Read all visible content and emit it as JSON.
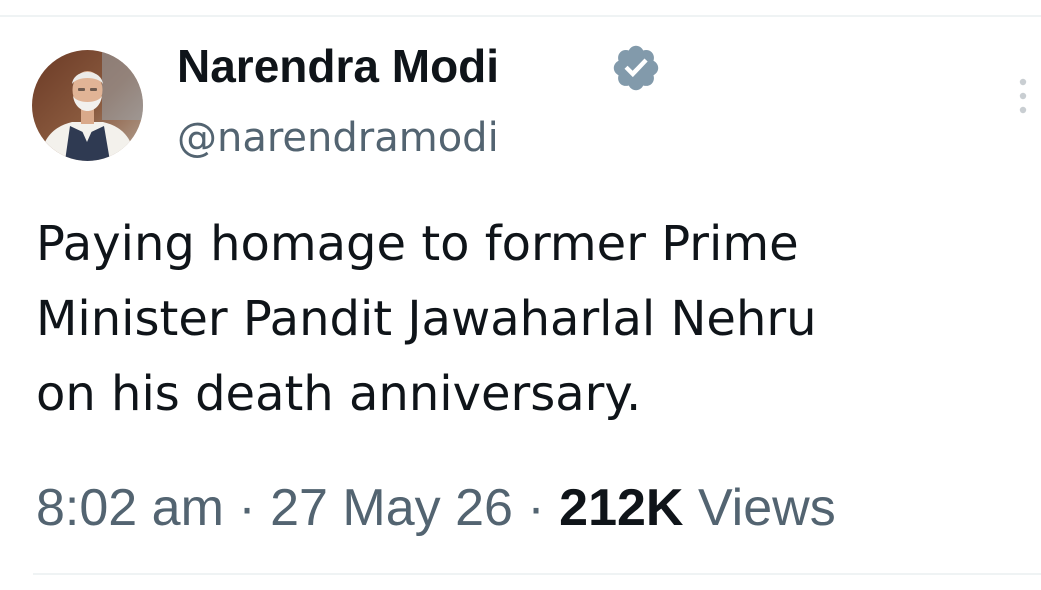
{
  "tweet": {
    "author": {
      "display_name": "Narendra Modi",
      "handle": "@narendramodi",
      "verified": true,
      "verified_icon": "verified-badge-icon",
      "avatar": "profile-photo"
    },
    "text": "Paying homage to former Prime\nMinister Pandit Jawaharlal Nehru\non his death anniversary.",
    "time": "8:02 am",
    "date": "27 May 26",
    "separator": "·",
    "views_count": "212K",
    "views_label": "Views",
    "more_icon": "more-options-icon"
  },
  "colors": {
    "text_primary": "#0f1419",
    "text_secondary": "#536471",
    "verified_badge": "#829aab",
    "divider": "#eff3f4"
  }
}
